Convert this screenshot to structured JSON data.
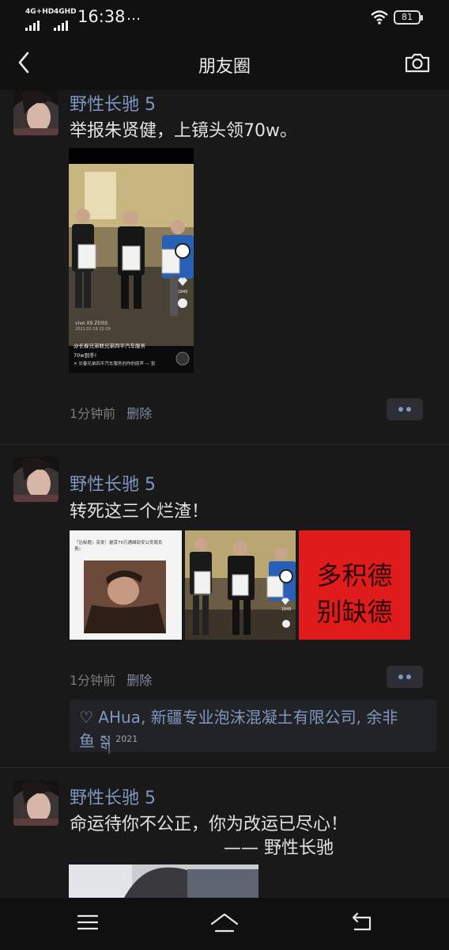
{
  "status_bar": {
    "sim1": "4G+HD",
    "sim2": "4GHD",
    "time": "16:38",
    "overflow": "…",
    "battery": "81"
  },
  "nav": {
    "title": "朋友圈",
    "back_icon": "chevron-left-icon",
    "camera_icon": "camera-icon"
  },
  "posts": [
    {
      "author": "野性长驰 5",
      "text": "举报朱贤健，上镜头领70w。",
      "video": {
        "caption1": "@长春兄弟联兄弟四平汽车服务",
        "caption2": "70w到手!",
        "caption3": "✕ 长春兄弟四平汽车服务创作的原声 — 张",
        "watermark": "vivo X9 ZEISS",
        "date": "2021.02.18 15:29",
        "like_count": "1849"
      },
      "time": "1分钟前",
      "delete": "删除"
    },
    {
      "author": "野性长驰 5",
      "text": "转死这三个烂渣！",
      "img1_lines": [
        "『沾标题』突发！悬赏70万通缉钦安公安局负",
        "责』"
      ],
      "img3_line1": "多积德",
      "img3_line2": "别缺德",
      "like_count": "1849",
      "time": "1分钟前",
      "delete": "删除",
      "likes_text": "♡ AHua, 新疆专业泡沫混凝土有限公司, 余非",
      "likes_text2": "鱼 སྒ",
      "likes_year": "2021"
    },
    {
      "author": "野性长驰 5",
      "text": "命运待你不公正，你为改运已尽心！",
      "text2": "——  野性长驰"
    }
  ],
  "bottom_nav": {
    "menu_icon": "menu-icon",
    "home_icon": "home-icon",
    "back_icon": "return-icon"
  },
  "colors": {
    "background": "#191919",
    "name": "#7f97c0",
    "red_poster": "#e01b1b"
  }
}
